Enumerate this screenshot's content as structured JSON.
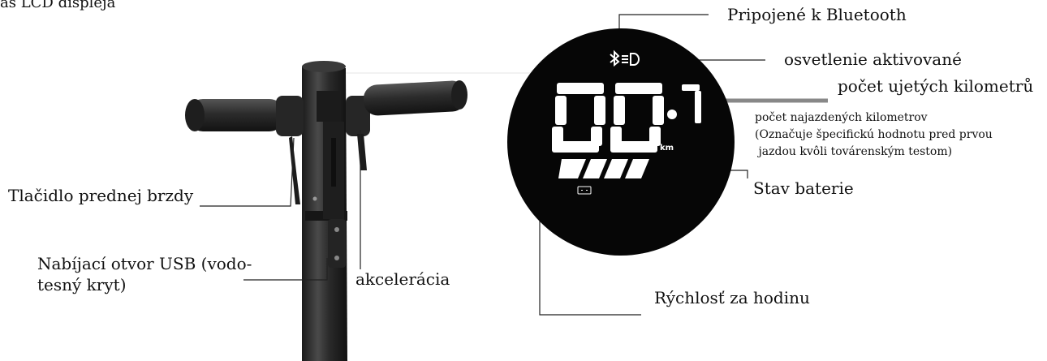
{
  "page_title_partial": "as LCD displeja",
  "display": {
    "bluetooth_icon": "bluetooth-icon",
    "headlight_icon": "headlight-icon",
    "speed_digits": "00",
    "trip_digit": "7",
    "unit": "km",
    "battery_segments": 4,
    "battery_icon": "battery-icon"
  },
  "labels": {
    "front_brake": "Tlačidlo prednej brzdy",
    "usb_port": "Nabíjací otvor USB (vodo-\ntesný kryt)",
    "accelerator": "akcelerácia",
    "bluetooth": "Pripojené k Bluetooth",
    "light": "osvetlenie aktivované",
    "trip_km": "počet ujetých kilometrů",
    "odometer": "počet najazdených kilometrov\n(Označuje špecifickú hodnotu pred prvou\n jazdou kvôli továrenským testom)",
    "battery": "Stav baterie",
    "speed": "Rýchlosť za hodinu"
  },
  "colors": {
    "display_bg": "#060606",
    "segment": "#ffffff",
    "scooter_body": "#2b2b2b",
    "leader_line": "#222222"
  }
}
